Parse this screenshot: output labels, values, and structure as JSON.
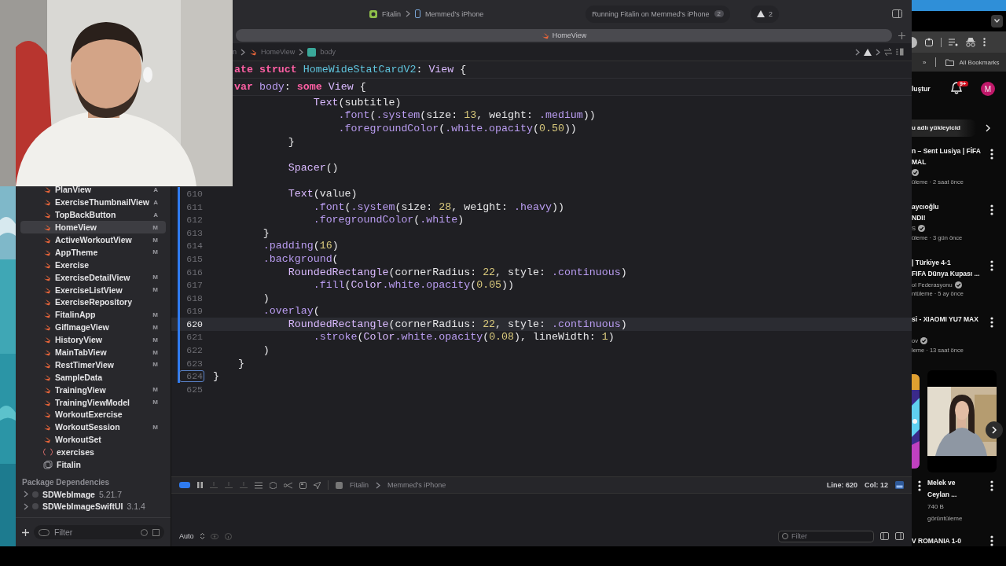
{
  "xcode": {
    "toolbar": {
      "scheme": "Fitalin",
      "device": "Memmed's iPhone",
      "status": "Running Fitalin on Memmed's iPhone",
      "status_badge": "2",
      "warnings": "2"
    },
    "tab": {
      "label": "HomeView"
    },
    "jump_bar": [
      {
        "label": "n",
        "kind": "text"
      },
      {
        "label": "HomeView",
        "kind": "swift"
      },
      {
        "label": "body",
        "kind": "property"
      }
    ],
    "sticky_headers": [
      {
        "code": [
          {
            "kind": "keyword",
            "text": "ate struct"
          },
          {
            "kind": "decl",
            "text": " HomeWideStatCardV2"
          },
          {
            "kind": "plain",
            "text": ": "
          },
          {
            "kind": "type",
            "text": "View"
          },
          {
            "kind": "plain",
            "text": " {"
          }
        ]
      },
      {
        "code": [
          {
            "kind": "keyword",
            "text": "var"
          },
          {
            "kind": "member",
            "text": " body"
          },
          {
            "kind": "plain",
            "text": ": "
          },
          {
            "kind": "keyword",
            "text": "some"
          },
          {
            "kind": "type",
            "text": " View"
          },
          {
            "kind": "plain",
            "text": " {"
          }
        ]
      }
    ],
    "lines": [
      {
        "current": false,
        "code": [
          {
            "kind": "type",
            "text": "                Text"
          },
          {
            "kind": "plain",
            "text": "(subtitle)"
          }
        ]
      },
      {
        "current": false,
        "code": [
          {
            "kind": "member",
            "text": "                    .font"
          },
          {
            "kind": "plain",
            "text": "("
          },
          {
            "kind": "member",
            "text": ".system"
          },
          {
            "kind": "plain",
            "text": "(size: "
          },
          {
            "kind": "number",
            "text": "13"
          },
          {
            "kind": "plain",
            "text": ", weight: "
          },
          {
            "kind": "member",
            "text": ".medium"
          },
          {
            "kind": "plain",
            "text": "))"
          }
        ]
      },
      {
        "current": false,
        "code": [
          {
            "kind": "member",
            "text": "                    .foregroundColor"
          },
          {
            "kind": "plain",
            "text": "("
          },
          {
            "kind": "member",
            "text": ".white.opacity"
          },
          {
            "kind": "plain",
            "text": "("
          },
          {
            "kind": "number",
            "text": "0.50"
          },
          {
            "kind": "plain",
            "text": "))"
          }
        ]
      },
      {
        "current": false,
        "code": [
          {
            "kind": "plain",
            "text": "            }"
          }
        ]
      },
      {
        "current": false
      },
      {
        "current": false,
        "code": [
          {
            "kind": "type",
            "text": "            Spacer"
          },
          {
            "kind": "plain",
            "text": "()"
          }
        ]
      },
      {
        "current": false
      },
      {
        "number": "610",
        "changed": true,
        "current": false,
        "marked": false,
        "code": [
          {
            "kind": "type",
            "text": "            Text"
          },
          {
            "kind": "plain",
            "text": "(value)"
          }
        ]
      },
      {
        "number": "611",
        "changed": true,
        "current": false,
        "marked": false,
        "code": [
          {
            "kind": "member",
            "text": "                .font"
          },
          {
            "kind": "plain",
            "text": "("
          },
          {
            "kind": "member",
            "text": ".system"
          },
          {
            "kind": "plain",
            "text": "(size: "
          },
          {
            "kind": "number",
            "text": "28"
          },
          {
            "kind": "plain",
            "text": ", weight: "
          },
          {
            "kind": "member",
            "text": ".heavy"
          },
          {
            "kind": "plain",
            "text": "))"
          }
        ]
      },
      {
        "number": "612",
        "changed": true,
        "current": false,
        "marked": false,
        "code": [
          {
            "kind": "member",
            "text": "                .foregroundColor"
          },
          {
            "kind": "plain",
            "text": "("
          },
          {
            "kind": "member",
            "text": ".white"
          },
          {
            "kind": "plain",
            "text": ")"
          }
        ]
      },
      {
        "number": "613",
        "changed": true,
        "current": false,
        "marked": false,
        "code": [
          {
            "kind": "plain",
            "text": "        }"
          }
        ]
      },
      {
        "number": "614",
        "changed": true,
        "current": false,
        "marked": false,
        "code": [
          {
            "kind": "member",
            "text": "        .padding"
          },
          {
            "kind": "plain",
            "text": "("
          },
          {
            "kind": "number",
            "text": "16"
          },
          {
            "kind": "plain",
            "text": ")"
          }
        ]
      },
      {
        "number": "615",
        "changed": true,
        "current": false,
        "marked": false,
        "code": [
          {
            "kind": "member",
            "text": "        .background"
          },
          {
            "kind": "plain",
            "text": "("
          }
        ]
      },
      {
        "number": "616",
        "changed": true,
        "current": false,
        "marked": false,
        "code": [
          {
            "kind": "type",
            "text": "            RoundedRectangle"
          },
          {
            "kind": "plain",
            "text": "(cornerRadius: "
          },
          {
            "kind": "number",
            "text": "22"
          },
          {
            "kind": "plain",
            "text": ", style: "
          },
          {
            "kind": "member",
            "text": ".continuous"
          },
          {
            "kind": "plain",
            "text": ")"
          }
        ]
      },
      {
        "number": "617",
        "changed": true,
        "current": false,
        "marked": false,
        "code": [
          {
            "kind": "member",
            "text": "                .fill"
          },
          {
            "kind": "plain",
            "text": "("
          },
          {
            "kind": "type",
            "text": "Color"
          },
          {
            "kind": "member",
            "text": ".white.opacity"
          },
          {
            "kind": "plain",
            "text": "("
          },
          {
            "kind": "number",
            "text": "0.05"
          },
          {
            "kind": "plain",
            "text": "))"
          }
        ]
      },
      {
        "number": "618",
        "changed": true,
        "current": false,
        "marked": false,
        "code": [
          {
            "kind": "plain",
            "text": "        )"
          }
        ]
      },
      {
        "number": "619",
        "changed": true,
        "current": false,
        "marked": false,
        "code": [
          {
            "kind": "member",
            "text": "        .overlay"
          },
          {
            "kind": "plain",
            "text": "("
          }
        ]
      },
      {
        "number": "620",
        "changed": true,
        "current": true,
        "marked": false,
        "code": [
          {
            "kind": "type",
            "text": "            RoundedRectangle"
          },
          {
            "kind": "plain",
            "text": "(cornerRadius: "
          },
          {
            "kind": "number",
            "text": "22"
          },
          {
            "kind": "plain",
            "text": ", style: "
          },
          {
            "kind": "member",
            "text": ".continuous"
          },
          {
            "kind": "plain",
            "text": ")"
          }
        ]
      },
      {
        "number": "621",
        "changed": true,
        "current": false,
        "marked": false,
        "code": [
          {
            "kind": "member",
            "text": "                .stroke"
          },
          {
            "kind": "plain",
            "text": "("
          },
          {
            "kind": "type",
            "text": "Color"
          },
          {
            "kind": "member",
            "text": ".white.opacity"
          },
          {
            "kind": "plain",
            "text": "("
          },
          {
            "kind": "number",
            "text": "0.08"
          },
          {
            "kind": "plain",
            "text": "), lineWidth: "
          },
          {
            "kind": "number",
            "text": "1"
          },
          {
            "kind": "plain",
            "text": ")"
          }
        ]
      },
      {
        "number": "622",
        "changed": true,
        "current": false,
        "marked": false,
        "code": [
          {
            "kind": "plain",
            "text": "        )"
          }
        ]
      },
      {
        "number": "623",
        "changed": true,
        "current": false,
        "marked": false,
        "code": [
          {
            "kind": "plain",
            "text": "    }"
          }
        ]
      },
      {
        "number": "624",
        "changed": true,
        "current": false,
        "marked": true,
        "code": [
          {
            "kind": "plain",
            "text": "}"
          }
        ]
      },
      {
        "number": "625",
        "changed": false,
        "current": false,
        "marked": false
      }
    ],
    "sidebar": {
      "items": [
        {
          "name": "PlanView",
          "kind": "swift",
          "status": "A",
          "selected": false
        },
        {
          "name": "ExerciseThumbnailView",
          "kind": "swift",
          "status": "A",
          "selected": false
        },
        {
          "name": "TopBackButton",
          "kind": "swift",
          "status": "A",
          "selected": false
        },
        {
          "name": "HomeView",
          "kind": "swift",
          "status": "M",
          "selected": true
        },
        {
          "name": "ActiveWorkoutView",
          "kind": "swift",
          "status": "M",
          "selected": false
        },
        {
          "name": "AppTheme",
          "kind": "swift",
          "status": "M",
          "selected": false
        },
        {
          "name": "Exercise",
          "kind": "swift",
          "selected": false
        },
        {
          "name": "ExerciseDetailView",
          "kind": "swift",
          "status": "M",
          "selected": false
        },
        {
          "name": "ExerciseListView",
          "kind": "swift",
          "status": "M",
          "selected": false
        },
        {
          "name": "ExerciseRepository",
          "kind": "swift",
          "selected": false
        },
        {
          "name": "FitalinApp",
          "kind": "swift",
          "status": "M",
          "selected": false
        },
        {
          "name": "GifImageView",
          "kind": "swift",
          "status": "M",
          "selected": false
        },
        {
          "name": "HistoryView",
          "kind": "swift",
          "status": "M",
          "selected": false
        },
        {
          "name": "MainTabView",
          "kind": "swift",
          "status": "M",
          "selected": false
        },
        {
          "name": "RestTimerView",
          "kind": "swift",
          "status": "M",
          "selected": false
        },
        {
          "name": "SampleData",
          "kind": "swift",
          "selected": false
        },
        {
          "name": "TrainingView",
          "kind": "swift",
          "status": "M",
          "selected": false
        },
        {
          "name": "TrainingViewModel",
          "kind": "swift",
          "status": "M",
          "selected": false
        },
        {
          "name": "WorkoutExercise",
          "kind": "swift",
          "selected": false
        },
        {
          "name": "WorkoutSession",
          "kind": "swift",
          "status": "M",
          "selected": false
        },
        {
          "name": "WorkoutSet",
          "kind": "swift",
          "selected": false
        },
        {
          "name": "exercises",
          "kind": "json",
          "selected": false
        },
        {
          "name": "Fitalin",
          "kind": "assets",
          "selected": false
        }
      ],
      "packages_title": "Package Dependencies",
      "packages": [
        {
          "name": "SDWebImage",
          "version": "5.21.7"
        },
        {
          "name": "SDWebImageSwiftUI",
          "version": "3.1.4"
        }
      ],
      "filter": {
        "placeholder": "Filter"
      }
    },
    "debug_bar": {
      "target": "Fitalin",
      "device": "Memmed's iPhone",
      "line": "Line: 620",
      "col": "Col: 12"
    },
    "console": {
      "mode": "Auto",
      "filter": {
        "placeholder": "Filter"
      }
    }
  },
  "browser": {
    "bookmarks_more": "»",
    "bookmarks": "All Bookmarks",
    "create": "luştur",
    "notifications": "9+",
    "avatar": "M",
    "chip": "u adlı yükleyicid",
    "videos": [
      {
        "title": "n – Sent Lusiya | FİFA\nMAL",
        "verified": true,
        "stats": "üleme · 2 saat önce"
      },
      {
        "title": "aycıoğlu\nNDI!",
        "channel": "S",
        "verified": true,
        "stats": "üleme · 3 gün önce"
      },
      {
        "title": "| Türkiye 4-1\nFIFA Dünya Kupası ...",
        "channel": "ol Federasyonu",
        "verified": true,
        "stats": "ntüleme · 5 ay önce"
      },
      {
        "title": "si - XIAOMI YU7 MAX",
        "channel": "ov",
        "verified": true,
        "stats": "leme · 13 saat önce"
      }
    ],
    "short": {
      "title": "Melek ve\nCeylan ...",
      "views": "740 B\ngörüntüleme"
    },
    "last_title": "V ROMANIA 1-0"
  }
}
